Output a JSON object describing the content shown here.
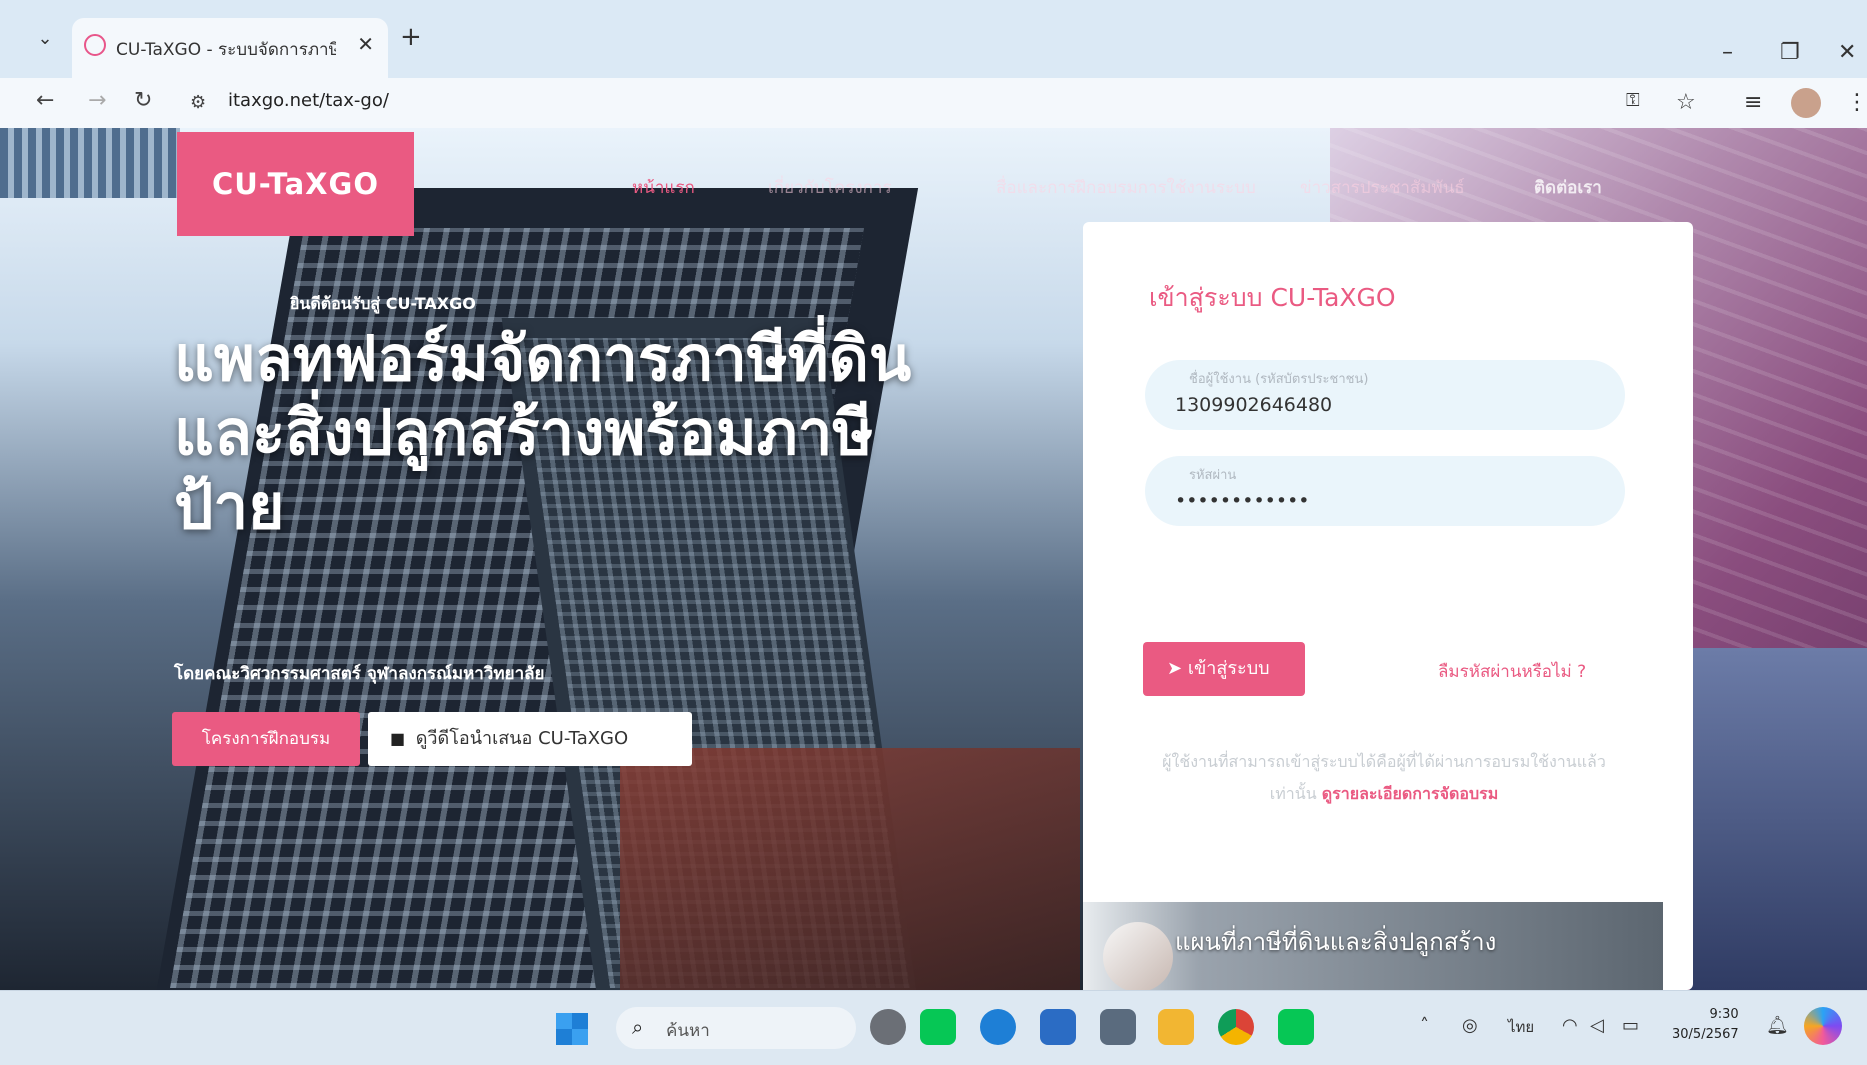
{
  "browser": {
    "tab_title": "CU-TaXGO - ระบบจัดการภาษีที่ดิ...",
    "url": "itaxgo.net/tax-go/",
    "icons": [
      "tab-search-icon",
      "favicon-icon",
      "close-icon",
      "plus-icon",
      "minimize-icon",
      "restore-icon",
      "window-close-icon",
      "back-icon",
      "forward-icon",
      "reload-icon",
      "site-settings-icon",
      "password-key-icon",
      "star-icon",
      "reading-list-icon",
      "profile-avatar",
      "menu-kebab-icon"
    ]
  },
  "site": {
    "logo": "CU-TaXGO",
    "nav": [
      "หน้าแรก",
      "เกี่ยวกับโครงการ",
      "สื่อและการฝึกอบรมการใช้งานระบบ",
      "ข่าวสารประชาสัมพันธ์",
      "ติดต่อเรา"
    ],
    "eyebrow": "ยินดีต้อนรับสู่ CU-TAXGO",
    "hero_line1": "แพลทฟอร์มจัดการภาษีที่ดิน",
    "hero_line2": "และสิ่งปลูกสร้างพร้อมภาษี",
    "hero_line3": "ป้าย",
    "hero_sub": "โดยคณะวิศวกรรมศาสตร์ จุฬาลงกรณ์มหาวิทยาลัย",
    "btn_training": "โครงการฝึกอบรม",
    "btn_video": "ดูวีดีโอนำเสนอ CU-TaXGO"
  },
  "login": {
    "title": "เข้าสู่ระบบ CU-TaXGO",
    "username_label": "ชื่อผู้ใช้งาน (รหัสบัตรประชาชน)",
    "username_value": "1309902646480",
    "password_label": "รหัสผ่าน",
    "password_value": "••••••••••••",
    "submit_label": "เข้าสู่ระบบ",
    "forgot_label": "ลืมรหัสผ่านหรือไม่ ?",
    "note_text": "ผู้ใช้งานที่สามารถเข้าสู่ระบบได้คือผู้ที่ได้ผ่านการอบรมใช้งานแล้วเท่านั้น",
    "note_link": "ดูรายละเอียดการจัดอบรม",
    "video_title": "แผนที่ภาษีที่ดินและสิ่งปลูกสร้าง"
  },
  "taskbar": {
    "search_placeholder": "ค้นหา",
    "time": "9:30",
    "date": "30/5/2567",
    "lang": "ไทย"
  },
  "colors": {
    "accent": "#ea5a82",
    "card": "#ffffff",
    "field": "#eaf5fb"
  }
}
